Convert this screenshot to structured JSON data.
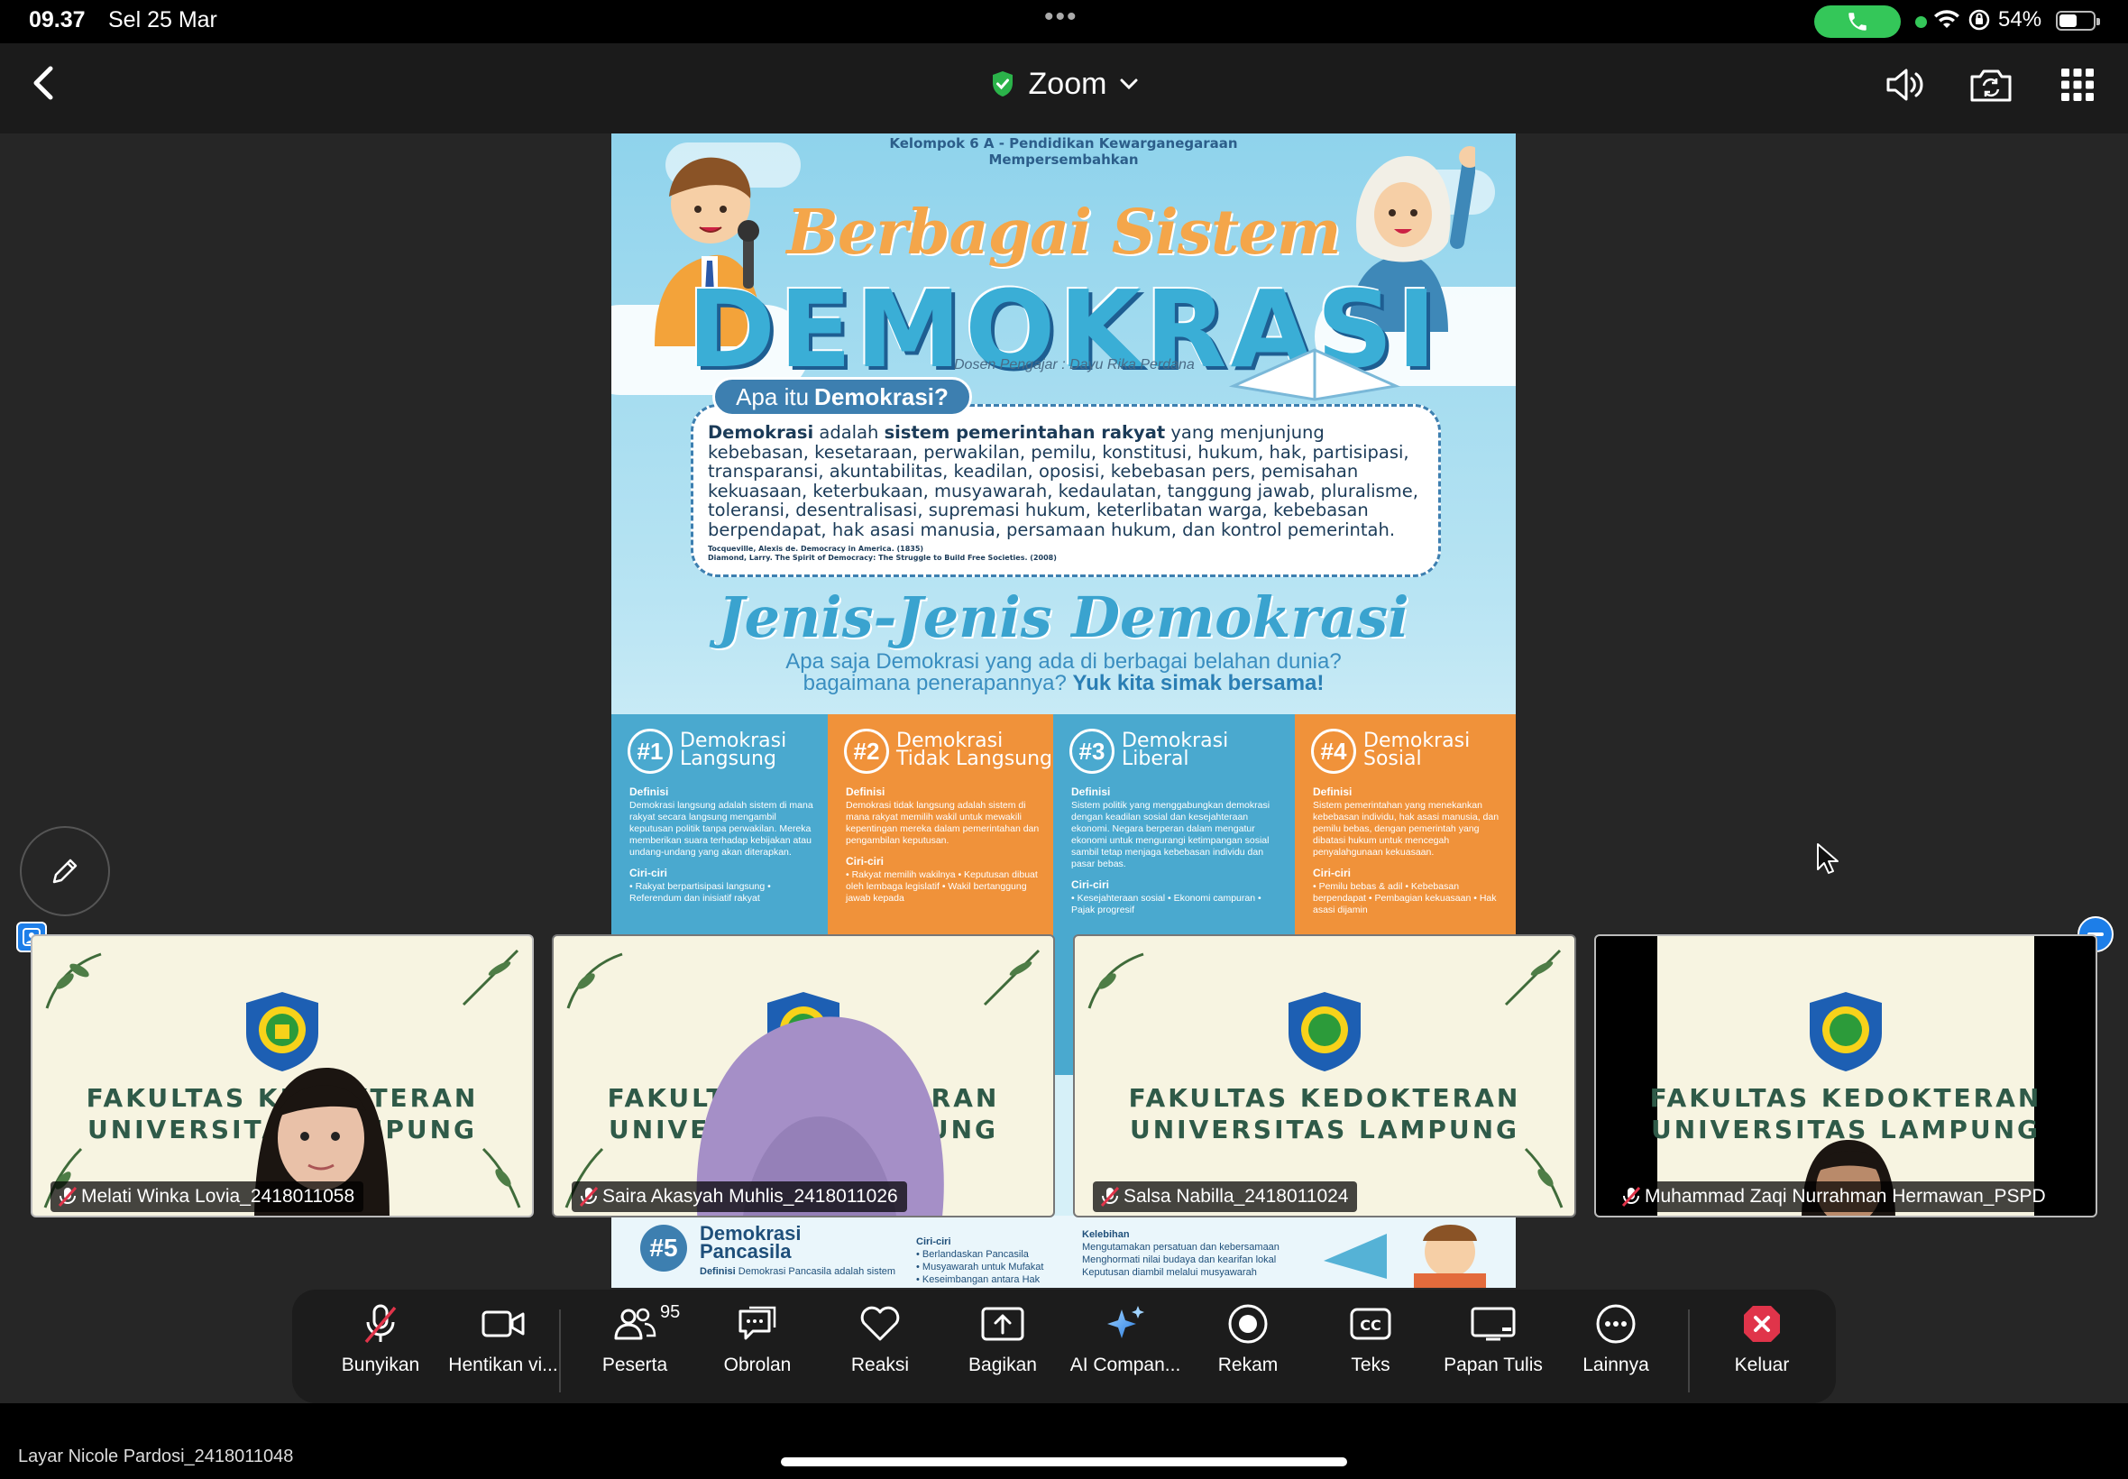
{
  "status_bar": {
    "time": "09.37",
    "date": "Sel 25 Mar",
    "battery": "54%",
    "battery_level": 0.54
  },
  "nav": {
    "title": "Zoom",
    "icons": [
      "back-icon",
      "shield-check-icon",
      "chevron-down-icon",
      "speaker-icon",
      "switch-camera-icon",
      "grid-icon"
    ]
  },
  "poster": {
    "header_line1": "Kelompok 6 A - Pendidikan Kewarganegaraan",
    "header_line2": "Mempersembahkan",
    "subtitle": "Berbagai Sistem",
    "title": "DEMOKRASI",
    "lecturer": "Dosen Pengajar : Dayu Rika Perdana",
    "def_badge_prefix": "Apa itu",
    "def_badge_bold": "Demokrasi?",
    "def_bold_1": "Demokrasi",
    "def_text_1": " adalah ",
    "def_bold_2": "sistem pemerintahan rakyat",
    "def_text_2": " yang menjunjung kebebasan, kesetaraan, perwakilan, pemilu, konstitusi, hukum, hak, partisipasi, transparansi, akuntabilitas, keadilan, oposisi, kebebasan pers, pemisahan kekuasaan, keterbukaan, musyawarah, kedaulatan, tanggung jawab, pluralisme, toleransi, desentralisasi, supremasi hukum, keterlibatan warga, kebebasan berpendapat, hak asasi manusia, persamaan hukum, dan kontrol pemerintah.",
    "ref_1": "Tocqueville, Alexis de. Democracy in America. (1835)",
    "ref_2": "Diamond, Larry. The Spirit of Democracy: The Struggle to Build Free Societies. (2008)",
    "jenis_title": "Jenis-Jenis Demokrasi",
    "jenis_q1": "Apa saja Demokrasi yang ada di berbagai belahan dunia?",
    "jenis_q2": "bagaimana penerapannya?",
    "jenis_q2_bold": "Yuk kita simak bersama!",
    "columns": [
      {
        "num": "#1",
        "title1": "Demokrasi",
        "title2": "Langsung",
        "color": "#4aa9cf",
        "def_h": "Definisi",
        "def": "Demokrasi langsung adalah sistem di mana rakyat secara langsung mengambil keputusan politik tanpa perwakilan. Mereka memberikan suara terhadap kebijakan atau undang-undang yang akan diterapkan.",
        "ciri_h": "Ciri-ciri",
        "ciri": "• Rakyat berpartisipasi langsung • Referendum dan inisiatif rakyat"
      },
      {
        "num": "#2",
        "title1": "Demokrasi",
        "title2": "Tidak Langsung",
        "color": "#f0923a",
        "def_h": "Definisi",
        "def": "Demokrasi tidak langsung adalah sistem di mana rakyat memilih wakil untuk mewakili kepentingan mereka dalam pemerintahan dan pengambilan keputusan.",
        "ciri_h": "Ciri-ciri",
        "ciri": "• Rakyat memilih wakilnya • Keputusan dibuat oleh lembaga legislatif • Wakil bertanggung jawab kepada"
      },
      {
        "num": "#3",
        "title1": "Demokrasi",
        "title2": "Liberal",
        "color": "#4aa9cf",
        "def_h": "Definisi",
        "def": "Sistem politik yang menggabungkan demokrasi dengan keadilan sosial dan kesejahteraan ekonomi. Negara berperan dalam mengatur ekonomi untuk mengurangi ketimpangan sosial sambil tetap menjaga kebebasan individu dan pasar bebas.",
        "ciri_h": "Ciri-ciri",
        "ciri": "• Kesejahteraan sosial • Ekonomi campuran • Pajak progresif"
      },
      {
        "num": "#4",
        "title1": "Demokrasi",
        "title2": "Sosial",
        "color": "#f0923a",
        "def_h": "Definisi",
        "def": "Sistem pemerintahan yang menekankan kebebasan individu, hak asasi manusia, dan pemilu bebas, dengan pemerintah yang dibatasi hukum untuk mencegah penyalahgunaan kekuasaan.",
        "ciri_h": "Ciri-ciri",
        "ciri": "• Pemilu bebas & adil • Kebebasan berpendapat • Pembagian kekuasaan • Hak asasi dijamin"
      }
    ],
    "bottom": {
      "num": "#5",
      "title1": "Demokrasi",
      "title2": "Pancasila",
      "def_h": "Definisi",
      "def": "Demokrasi Pancasila adalah sistem",
      "ciri_h": "Ciri-ciri",
      "ciri1": "• Berlandaskan Pancasila",
      "ciri2": "• Musyawarah untuk Mufakat",
      "ciri3": "• Keseimbangan antara Hak",
      "keleb_h": "Kelebihan",
      "keleb1": "Mengutamakan persatuan dan kebersamaan",
      "keleb2": "Menghormati nilai budaya dan kearifan lokal",
      "keleb3": "Keputusan diambil melalui musyawarah"
    }
  },
  "tiles": [
    {
      "name": "Melati Winka Lovia_2418011058",
      "line1": "FAKULTAS KEDOKTERAN",
      "line2": "UNIVERSITAS LAMPUNG"
    },
    {
      "name": "Saira Akasyah Muhlis_2418011026",
      "line1": "FAKULTAS KEDOKTERAN",
      "line2": "UNIVERSITAS LAMPUNG"
    },
    {
      "name": "Salsa Nabilla_2418011024",
      "line1": "FAKULTAS KEDOKTERAN",
      "line2": "UNIVERSITAS LAMPUNG"
    },
    {
      "name": "Muhammad Zaqi Nurrahman Hermawan_PSPD",
      "line1": "FAKULTAS KEDOKTERAN",
      "line2": "UNIVERSITAS LAMPUNG"
    }
  ],
  "toolbar": {
    "unmute": "Bunyikan",
    "stop_video": "Hentikan vi...",
    "participants": "Peserta",
    "participants_count": "95",
    "chat": "Obrolan",
    "reactions": "Reaksi",
    "share": "Bagikan",
    "ai": "AI Compan...",
    "record": "Rekam",
    "captions": "Teks",
    "whiteboard": "Papan Tulis",
    "more": "Lainnya",
    "leave": "Keluar"
  },
  "sharer": "Layar Nicole Pardosi_2418011048",
  "colors": {
    "accent_green": "#34c759",
    "accent_blue": "#1d7ee8",
    "leave_red": "#e0344a"
  }
}
